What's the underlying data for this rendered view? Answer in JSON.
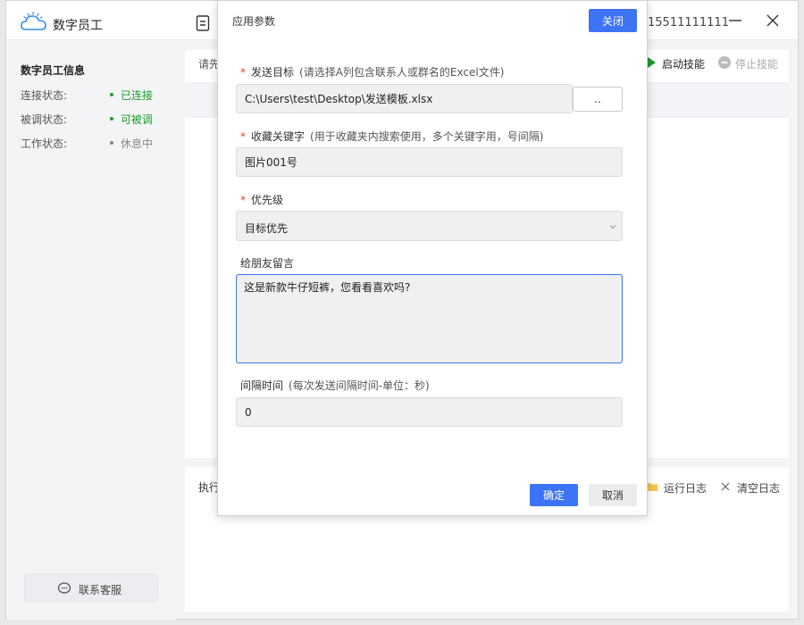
{
  "app": {
    "name": "数字员工",
    "phone": "15511111111"
  },
  "sidebar": {
    "title": "数字员工信息",
    "rows": [
      {
        "key": "连接状态:",
        "value": "已连接",
        "color": "#1a9b2c"
      },
      {
        "key": "被调状态:",
        "value": "可被调",
        "color": "#1a9b2c"
      },
      {
        "key": "工作状态:",
        "value": "休息中",
        "color": "#888888"
      }
    ],
    "support_label": "联系客服"
  },
  "main": {
    "search_label": "请先",
    "start_skill_label": "启动技能",
    "stop_skill_label": "停止技能",
    "exec_label": "执行",
    "run_log_label": "运行日志",
    "clear_log_label": "清空日志"
  },
  "dialog": {
    "title": "应用参数",
    "close_label": "关闭",
    "fields": {
      "target": {
        "label": "发送目标",
        "hint": "(请选择A列包含联系人或群名的Excel文件)",
        "value": "C:\\Users\\test\\Desktop\\发送模板.xlsx",
        "browse_label": ".."
      },
      "keyword": {
        "label": "收藏关键字",
        "hint": "(用于收藏夹内搜索使用，多个关键字用，号间隔)",
        "value": "图片001号"
      },
      "priority": {
        "label": "优先级",
        "value": "目标优先"
      },
      "message": {
        "label": "给朋友留言",
        "value": "这是新款牛仔短裤，您看看喜欢吗?"
      },
      "interval": {
        "label": "间隔时间",
        "hint": "(每次发送间隔时间-单位：秒)",
        "value": "0"
      }
    },
    "ok_label": "确定",
    "cancel_label": "取消"
  },
  "colors": {
    "accent": "#3d73f5",
    "required": "#e53935",
    "online": "#1a9b2c"
  }
}
